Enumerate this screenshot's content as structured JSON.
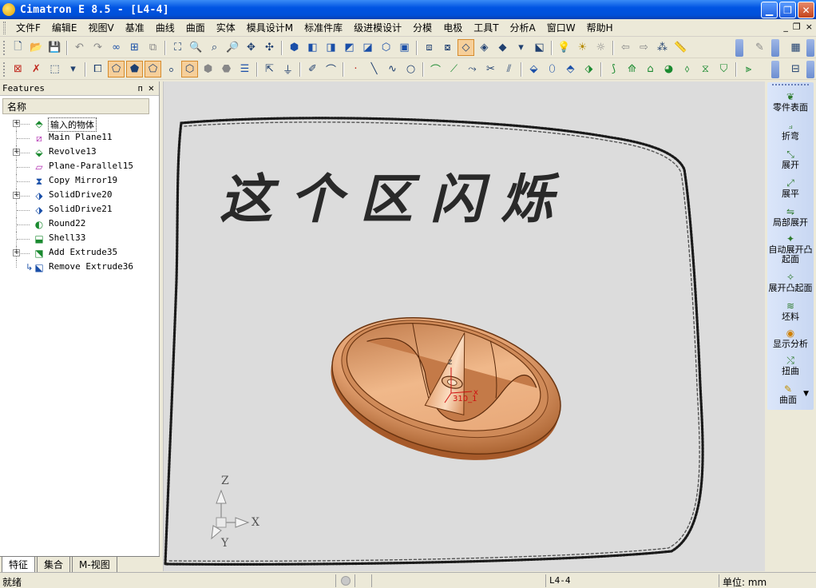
{
  "window": {
    "title": "Cimatron E 8.5 - [L4-4]",
    "min_glyph": "▁",
    "max_glyph": "❐",
    "close_glyph": "✕"
  },
  "menu": {
    "items": [
      "文件F",
      "编辑E",
      "视图V",
      "基准",
      "曲线",
      "曲面",
      "实体",
      "模具设计M",
      "标准件库",
      "级进模设计",
      "分模",
      "电极",
      "工具T",
      "分析A",
      "窗口W",
      "帮助H"
    ],
    "mdi_min": "_",
    "mdi_restore": "❐",
    "mdi_close": "×"
  },
  "features_panel": {
    "title": "Features",
    "pin": "ᴨ",
    "close": "✕",
    "column_header": "名称",
    "items": [
      {
        "label": "输入的物体",
        "icon": "input-body-icon",
        "expandable": true,
        "selected": true
      },
      {
        "label": "Main Plane11",
        "icon": "plane-icon",
        "expandable": false
      },
      {
        "label": "Revolve13",
        "icon": "revolve-icon",
        "expandable": true
      },
      {
        "label": "Plane-Parallel15",
        "icon": "parallel-plane-icon",
        "expandable": false
      },
      {
        "label": "Copy Mirror19",
        "icon": "mirror-icon",
        "expandable": false
      },
      {
        "label": "SolidDrive20",
        "icon": "solid-drive-icon",
        "expandable": true
      },
      {
        "label": "SolidDrive21",
        "icon": "solid-drive-icon",
        "expandable": false
      },
      {
        "label": "Round22",
        "icon": "round-icon",
        "expandable": false
      },
      {
        "label": "Shell33",
        "icon": "shell-icon",
        "expandable": false
      },
      {
        "label": "Add Extrude35",
        "icon": "add-extrude-icon",
        "expandable": true
      },
      {
        "label": "Remove Extrude36",
        "icon": "remove-extrude-icon",
        "expandable": false
      }
    ],
    "tabs": [
      "特征",
      "集合",
      "M-视图"
    ]
  },
  "viewport": {
    "handwritten_text": "这个区闪烁",
    "triad": {
      "x": "X",
      "y": "Y",
      "z": "Z"
    },
    "part_axis_z": "z",
    "part_axis_x": "x",
    "part_label": "310_1"
  },
  "palette": {
    "items": [
      {
        "label": "零件表面"
      },
      {
        "label": "折弯"
      },
      {
        "label": "展开"
      },
      {
        "label": "展平"
      },
      {
        "label": "局部展开"
      },
      {
        "label": "自动展开凸起面"
      },
      {
        "label": "展开凸起面"
      },
      {
        "label": "坯料"
      },
      {
        "label": "显示分析"
      },
      {
        "label": "扭曲"
      },
      {
        "label": "曲面"
      }
    ]
  },
  "status": {
    "left": "就绪",
    "document": "L4-4",
    "units": "单位: mm"
  },
  "colors": {
    "title_blue": "#0054e3",
    "part_copper": "#e0a070",
    "viewport_bg": "#dcdcdc",
    "active_tool": "#f6cf9a"
  }
}
